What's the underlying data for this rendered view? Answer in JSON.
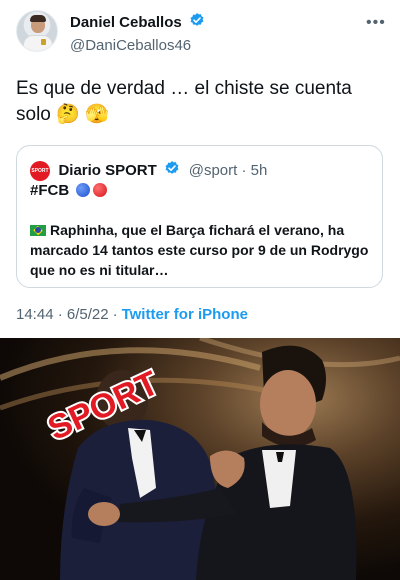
{
  "tweet": {
    "display_name": "Daniel Ceballos",
    "handle": "@DaniCeballos46",
    "text": "Es que de verdad … el chiste se cuenta solo 🤔 🫣",
    "timestamp": "14:44 · 6/5/22",
    "separator": "·",
    "source": "Twitter for iPhone"
  },
  "quote": {
    "logo_text": "SPORT",
    "name": "Diario SPORT",
    "handle": "@sport · 5h",
    "hashtag": "#FCB",
    "body": "Raphinha, que el Barça fichará el verano, ha marcado 14 tantos este curso por 9 de un Rodrygo que no es ni titular…"
  },
  "image": {
    "overlay_text": "SPORT"
  },
  "colors": {
    "link": "#1d9bf0",
    "secondary_text": "#536471",
    "sport_red": "#e21a23",
    "border": "#cfd9de"
  }
}
